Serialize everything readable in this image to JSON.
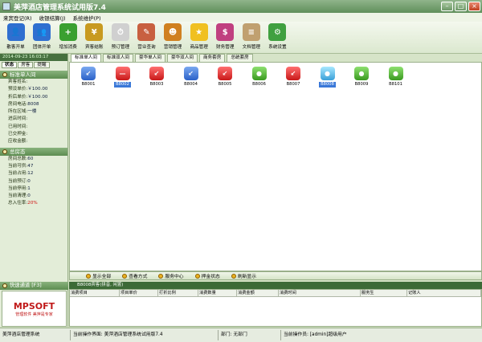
{
  "app": {
    "title": "美萍酒店管理系统试用版7.4"
  },
  "menu": [
    "来宾登记(R)",
    "收银结算(J)",
    "系统维护(P)"
  ],
  "toolbar": [
    {
      "label": "散客开单",
      "icon": "guest-checkin-icon",
      "color": "#2f6fd0",
      "glyph": "👤"
    },
    {
      "label": "团体开单",
      "icon": "group-checkin-icon",
      "color": "#2f6fd0",
      "glyph": "👥"
    },
    {
      "label": "增加消费",
      "icon": "add-consumption-icon",
      "color": "#3aa030",
      "glyph": "+"
    },
    {
      "label": "宾客结账",
      "icon": "checkout-icon",
      "color": "#c89a20",
      "glyph": "¥"
    },
    {
      "label": "预订管理",
      "icon": "reservation-clock-icon",
      "color": "#d0d0d0",
      "glyph": "⏱"
    },
    {
      "label": "营业查询",
      "icon": "business-query-icon",
      "color": "#c86040",
      "glyph": "✎"
    },
    {
      "label": "营销管理",
      "icon": "marketing-icon",
      "color": "#d08020",
      "glyph": "☻"
    },
    {
      "label": "商品管理",
      "icon": "goods-star-icon",
      "color": "#f0c020",
      "glyph": "★"
    },
    {
      "label": "财务管理",
      "icon": "finance-icon",
      "color": "#c04080",
      "glyph": "$"
    },
    {
      "label": "文档管理",
      "icon": "document-icon",
      "color": "#c0a070",
      "glyph": "≡"
    },
    {
      "label": "系统设置",
      "icon": "settings-gear-icon",
      "color": "#40a040",
      "glyph": "⚙"
    }
  ],
  "left": {
    "datetime": "2014-09-23 16:03:17",
    "tabs": [
      "状态",
      "房客",
      "提醒"
    ],
    "room_section_title": "标准单人间",
    "room_fields": [
      {
        "k": "宾客姓名:",
        "v": ""
      },
      {
        "k": "预设单价:",
        "v": "￥100.00"
      },
      {
        "k": "折后单价:",
        "v": "￥100.00"
      },
      {
        "k": "房间电话:",
        "v": "8008"
      },
      {
        "k": "所在区域:",
        "v": "一楼"
      },
      {
        "k": "进店时间:",
        "v": ""
      },
      {
        "k": "已用时间:",
        "v": ""
      },
      {
        "k": "已交押金:",
        "v": ""
      },
      {
        "k": "应收金额:",
        "v": ""
      }
    ],
    "status_section_title": "总房态",
    "status_fields": [
      {
        "k": "房间总数:",
        "v": "60"
      },
      {
        "k": "当前可供:",
        "v": "47"
      },
      {
        "k": "当前占用:",
        "v": "12"
      },
      {
        "k": "当前预订:",
        "v": "0"
      },
      {
        "k": "当前停用:",
        "v": "1"
      },
      {
        "k": "当前清理:",
        "v": "0"
      },
      {
        "k": "总入住率:",
        "v": "20%"
      }
    ],
    "quick_title": "快速通道 [F3]",
    "logo_text": "MPSOFT",
    "logo_sub1": "管理软件",
    "logo_sub2": "美萍是专家"
  },
  "room_tabs": [
    "标准单人间",
    "标准双人间",
    "豪华单人间",
    "豪华双人间",
    "商务套房",
    "总统套房"
  ],
  "rooms": [
    {
      "id": "B8001",
      "state": "blue",
      "glyph": "↙",
      "selected": false
    },
    {
      "id": "B8002",
      "state": "red",
      "glyph": "—",
      "selected": true
    },
    {
      "id": "B8003",
      "state": "red",
      "glyph": "↙",
      "selected": false
    },
    {
      "id": "B8004",
      "state": "blue",
      "glyph": "↙",
      "selected": false
    },
    {
      "id": "B8005",
      "state": "red",
      "glyph": "↙",
      "selected": false
    },
    {
      "id": "B8006",
      "state": "green",
      "glyph": "●",
      "selected": false
    },
    {
      "id": "B8007",
      "state": "red",
      "glyph": "↙",
      "selected": false
    },
    {
      "id": "B8008",
      "state": "cyan",
      "glyph": "●",
      "selected": true
    },
    {
      "id": "B8009",
      "state": "green",
      "glyph": "●",
      "selected": false
    },
    {
      "id": "B8101",
      "state": "green",
      "glyph": "●",
      "selected": false
    }
  ],
  "actions": [
    "显示全部",
    "查看方式",
    "服务中心",
    "押金状态",
    "刷新显示"
  ],
  "cash": {
    "header": "B8008宾客(拼音, 闲置)",
    "columns": [
      "消费项目",
      "项目单价",
      "打折比例",
      "消费数量",
      "消费金额",
      "消费时间",
      "服务生",
      "记账人"
    ]
  },
  "status": {
    "app_name": "美萍酒店管理系统",
    "current_interface": "当前操作界面: 美萍酒店管理系统试用版7.4",
    "dept": "部门: 无部门",
    "operator": "当前操作员: [admin]超级用户"
  }
}
